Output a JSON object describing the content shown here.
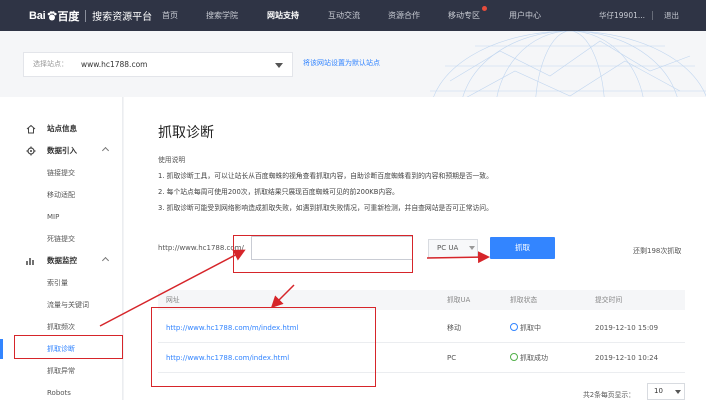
{
  "header": {
    "logo_text": "Bai",
    "logo_text2": "百度",
    "platform_title": "搜索资源平台",
    "nav": [
      "首页",
      "搜索学院",
      "网站支持",
      "互动交流",
      "资源合作",
      "移动专区",
      "用户中心"
    ],
    "active_nav": "网站支持",
    "username": "华仔19901...",
    "logout": "退出"
  },
  "site_selector": {
    "label": "选择站点：",
    "value": "www.hc1788.com",
    "default_link": "将该网站设置为默认站点"
  },
  "sidebar": {
    "groups": [
      {
        "label": "站点信息",
        "icon": "home-icon"
      },
      {
        "label": "数据引入",
        "icon": "gear-icon"
      },
      {
        "label": "数据监控",
        "icon": "chart-icon"
      }
    ],
    "items_import": [
      "链接提交",
      "移动适配",
      "MIP",
      "死链提交"
    ],
    "items_monitor": [
      "索引量",
      "流量与关键词",
      "抓取频次",
      "抓取诊断",
      "抓取异常",
      "Robots"
    ],
    "active_item": "抓取诊断"
  },
  "main": {
    "title": "抓取诊断",
    "usage_title": "使用说明",
    "usage": [
      "1. 抓取诊断工具，可以让站长从百度蜘蛛的视角查看抓取内容，自助诊断百度蜘蛛看到的内容和预期是否一致。",
      "2. 每个站点每周可使用200次，抓取结果只展现百度蜘蛛可见的前200KB内容。",
      "3. 抓取诊断可能受到网络影响造成抓取失败，如遇到抓取失败情况，可重新检测，并自查网站是否可正常访问。"
    ],
    "url_prefix": "http://www.hc1788.com/",
    "url_input_value": "",
    "ua_value": "PC UA",
    "fetch_button": "抓取",
    "remaining": "还剩198次抓取",
    "table": {
      "headers": [
        "网址",
        "抓取UA",
        "抓取状态",
        "提交时间"
      ],
      "rows": [
        {
          "url": "http://www.hc1788.com/m/index.html",
          "ua": "移动",
          "status": "抓取中",
          "status_type": "crawling",
          "time": "2019-12-10 15:09"
        },
        {
          "url": "http://www.hc1788.com/index.html",
          "ua": "PC",
          "status": "抓取成功",
          "status_type": "success",
          "time": "2019-12-10 10:24"
        }
      ]
    },
    "pagination": {
      "total": "共2条",
      "per_page_label": "每页显示：",
      "per_page_value": "10"
    }
  },
  "colors": {
    "accent": "#3385ff",
    "nav_bg": "#2f3445",
    "annotation": "#d6252a",
    "success": "#52b04a"
  }
}
